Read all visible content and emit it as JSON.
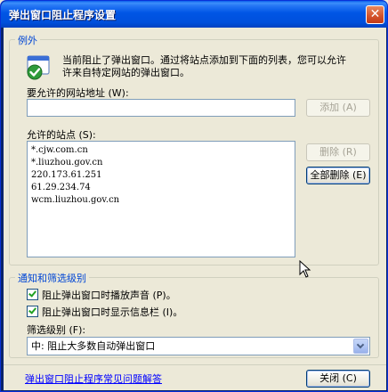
{
  "window": {
    "title": "弹出窗口阻止程序设置",
    "close_glyph": "✕"
  },
  "exceptions": {
    "group_label": "例外",
    "info_text": "当前阻止了弹出窗口。通过将站点添加到下面的列表，您可以允许\n许来自特定网站的弹出窗口。",
    "address_label": "要允许的网站地址 (W):",
    "address_value": "",
    "add_button": "添加 (A)",
    "allowed_label": "允许的站点 (S):",
    "allowed_sites": [
      "*.cjw.com.cn",
      "*.liuzhou.gov.cn",
      "220.173.61.251",
      "61.29.234.74",
      "wcm.liuzhou.gov.cn"
    ],
    "remove_button": "删除 (R)",
    "remove_all_button": "全部删除 (E)"
  },
  "notifications": {
    "group_label": "通知和筛选级别",
    "play_sound_label": "阻止弹出窗口时播放声音 (P)。",
    "play_sound_checked": true,
    "show_infobar_label": "阻止弹出窗口时显示信息栏 (I)。",
    "show_infobar_checked": true,
    "filter_label": "筛选级别 (F):",
    "filter_value": "中: 阻止大多数自动弹出窗口"
  },
  "footer": {
    "faq_link": "弹出窗口阻止程序常见问题解答",
    "close_button": "关闭 (C)"
  },
  "colors": {
    "titlebar": "#0055e5",
    "group_label": "#0046d5",
    "link": "#0000ff",
    "dialog_bg": "#ece9d8"
  }
}
